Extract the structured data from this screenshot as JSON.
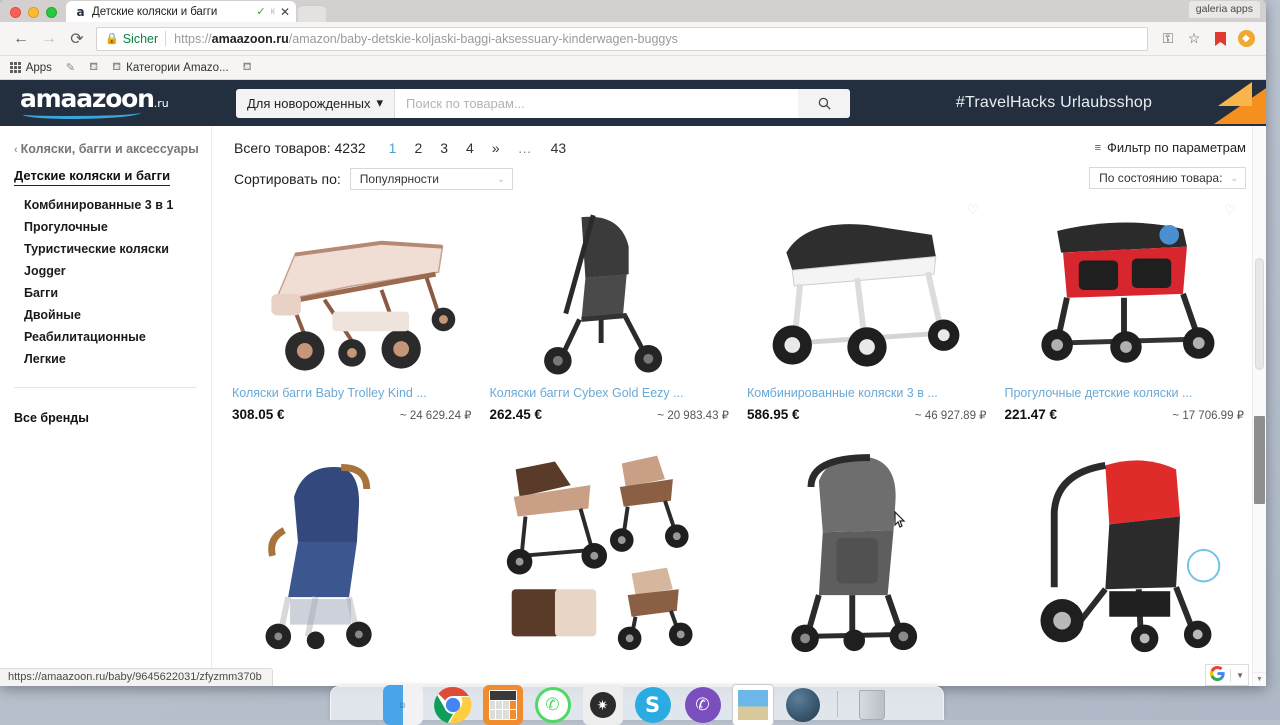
{
  "browser": {
    "tab": {
      "title": "Детские коляски и багги",
      "favicon": "amazon-a-icon",
      "check_glyph": "✓",
      "k_glyph": "к",
      "close_glyph": "✕"
    },
    "galeria_chip": "galeria apps",
    "nav": {
      "back": "←",
      "forward": "→",
      "reload": "⟳"
    },
    "omnibox": {
      "lock_icon": "lock-icon",
      "secure_label": "Sicher",
      "url_scheme": "https://",
      "url_host": "amaazoon.ru",
      "url_path": "/amazon/baby-detskie-koljaski-baggi-aksessuary-kinderwagen-buggys"
    },
    "toolbar_icons": {
      "key": "⚿",
      "star": "☆",
      "bookmark": "🔖",
      "profile": "●"
    },
    "bookmarks": [
      {
        "label": "Apps",
        "icon": "apps-grid-icon"
      },
      {
        "label": "",
        "icon": "pen-icon"
      },
      {
        "label": "",
        "icon": "stroller-icon"
      },
      {
        "label": "Категории Amazo...",
        "icon": "stroller-icon"
      },
      {
        "label": "",
        "icon": "stroller-icon"
      }
    ],
    "status_url": "https://amaazoon.ru/baby/9645622031/zfyzmm370b"
  },
  "site": {
    "logo": {
      "name": "amaazoon",
      "suffix": ".ru"
    },
    "search": {
      "category": "Для новорожденных",
      "category_caret": "▾",
      "placeholder": "Поиск по товарам...",
      "button_icon": "search-icon"
    },
    "promo": "#TravelHacks Urlaubsshop"
  },
  "sidebar": {
    "breadcrumb": "Коляски, багги и аксессуары",
    "breadcrumb_arrow": "‹",
    "active_category": "Детские коляски и багги",
    "items": [
      {
        "label": "Комбинированные 3 в 1"
      },
      {
        "label": "Прогулочные"
      },
      {
        "label": "Туристические коляски"
      },
      {
        "label": "Jogger"
      },
      {
        "label": "Багги"
      },
      {
        "label": "Двойные"
      },
      {
        "label": "Реабилитационные"
      },
      {
        "label": "Легкие"
      }
    ],
    "all_brands": "Все бренды"
  },
  "toolbar": {
    "total_label": "Всего товаров: 4232",
    "pages": [
      "1",
      "2",
      "3",
      "4",
      "»",
      "…",
      "43"
    ],
    "active_page": "1",
    "sort_label": "Сортировать по:",
    "sort_value": "Популярности",
    "filter_label": "Фильтр по параметрам",
    "filter_icon": "filter-icon",
    "condition_value": "По состоянию товара:"
  },
  "products_row1": [
    {
      "title": "Коляски багги Baby Trolley Kind ...",
      "price_eur": "308.05 €",
      "price_rub": "~ 24 629.24 ₽",
      "image": "rose-gold-stroller"
    },
    {
      "title": "Коляски багги Cybex Gold Eezy ...",
      "price_eur": "262.45 €",
      "price_rub": "~ 20 983.43 ₽",
      "image": "black-compact-stroller"
    },
    {
      "title": "Комбинированные коляски 3 в ...",
      "price_eur": "586.95 €",
      "price_rub": "~ 46 927.89 ₽",
      "image": "white-black-pram"
    },
    {
      "title": "Прогулочные детские коляски ...",
      "price_eur": "221.47 €",
      "price_rub": "~ 17 706.99 ₽",
      "image": "red-black-stroller"
    }
  ],
  "products_row2": [
    {
      "image": "blue-compact-stroller"
    },
    {
      "image": "brown-pram-set"
    },
    {
      "image": "grey-buggy"
    },
    {
      "image": "red-canopy-stroller"
    }
  ],
  "google_badge": {
    "logo": "G",
    "caret": "▼"
  },
  "dock": [
    {
      "name": "finder-icon",
      "color": "#4aa5e8"
    },
    {
      "name": "chrome-icon",
      "color": "#dd4b39"
    },
    {
      "name": "calculator-icon",
      "color": "#f08c2e"
    },
    {
      "name": "phone-icon",
      "color": "#4cd964"
    },
    {
      "name": "settings-icon",
      "color": "#3a3a3a"
    },
    {
      "name": "skype-icon",
      "color": "#2aabe2"
    },
    {
      "name": "viber-icon",
      "color": "#7b4ebd"
    },
    {
      "name": "photos-icon",
      "color": "#2f6fb5"
    },
    {
      "name": "preview-icon",
      "color": "#31556e"
    },
    {
      "name": "trash-icon",
      "color": "#c8ccd2"
    }
  ]
}
